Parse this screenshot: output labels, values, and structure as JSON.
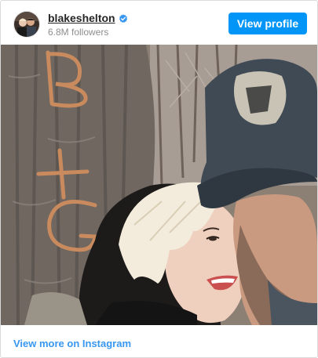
{
  "profile": {
    "username": "blakeshelton",
    "followers": "6.8M followers",
    "verified": true,
    "avatar_icon": "profile-photo-avatar"
  },
  "actions": {
    "view_profile_label": "View profile",
    "view_more_label": "View more on Instagram"
  },
  "post": {
    "media_icon": "post-photo",
    "carved_letters": [
      "B",
      "+",
      "G"
    ]
  },
  "colors": {
    "accent": "#0095f6",
    "link": "#3897f0",
    "verified_badge": "#3897f0",
    "username": "#262626",
    "muted": "#8e8e8e",
    "border": "#dbdbdb"
  }
}
